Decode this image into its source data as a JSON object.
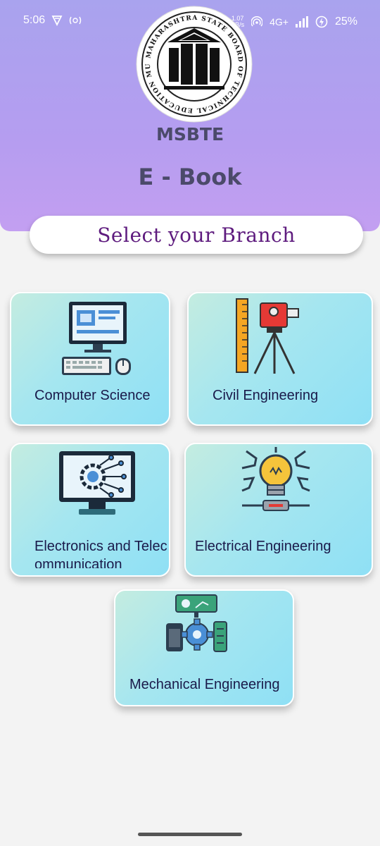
{
  "status_bar": {
    "time": "5:06",
    "speed_value": "1.07",
    "speed_unit": "KB/s",
    "network": "4G+",
    "battery": "25%",
    "icons": [
      "vpn-icon",
      "nfc-icon",
      "volte-icon",
      "hotspot-icon",
      "signal-icon",
      "battery-icon"
    ]
  },
  "header": {
    "logo_text": "MAHARASHTRA STATE BOARD OF TECHNICAL EDUCATION MUMBAI",
    "app_name": "MSBTE",
    "subtitle": "E - Book"
  },
  "select_label": "Select your Branch",
  "branches": [
    {
      "label": "Computer Science",
      "icon": "computer-icon"
    },
    {
      "label": "Civil Engineering",
      "icon": "surveying-icon"
    },
    {
      "label": "Electronics and Telecommunication",
      "icon": "circuit-monitor-icon"
    },
    {
      "label": "Electrical Engineering",
      "icon": "lightbulb-icon"
    },
    {
      "label": "Mechanical Engineering",
      "icon": "gears-icon"
    }
  ],
  "colors": {
    "header_top": "#a9a3ee",
    "header_bottom": "#c39ff1",
    "title_text": "#4b4a6a",
    "select_text": "#5e1b7e",
    "card_start": "#c4ece0",
    "card_end": "#8fe0f5"
  }
}
